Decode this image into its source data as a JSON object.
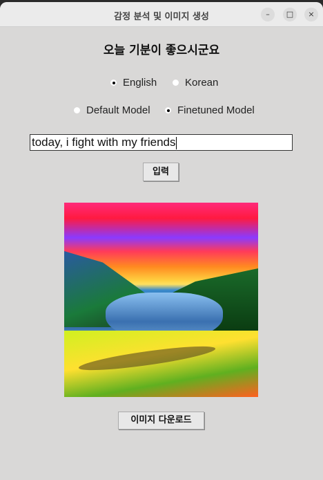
{
  "window": {
    "title": "감정 분석 및 이미지 생성",
    "minimize": "–",
    "maximize": "□",
    "close": "×"
  },
  "heading": "오늘 기분이 좋으시군요",
  "language": {
    "options": [
      {
        "label": "English",
        "selected": true
      },
      {
        "label": "Korean",
        "selected": false
      }
    ]
  },
  "model": {
    "options": [
      {
        "label": "Default Model",
        "selected": false
      },
      {
        "label": "Finetuned Model",
        "selected": true
      }
    ]
  },
  "input": {
    "value": "today, i fight with my friends"
  },
  "submit_label": "입력",
  "download_label": "이미지 다운로드"
}
